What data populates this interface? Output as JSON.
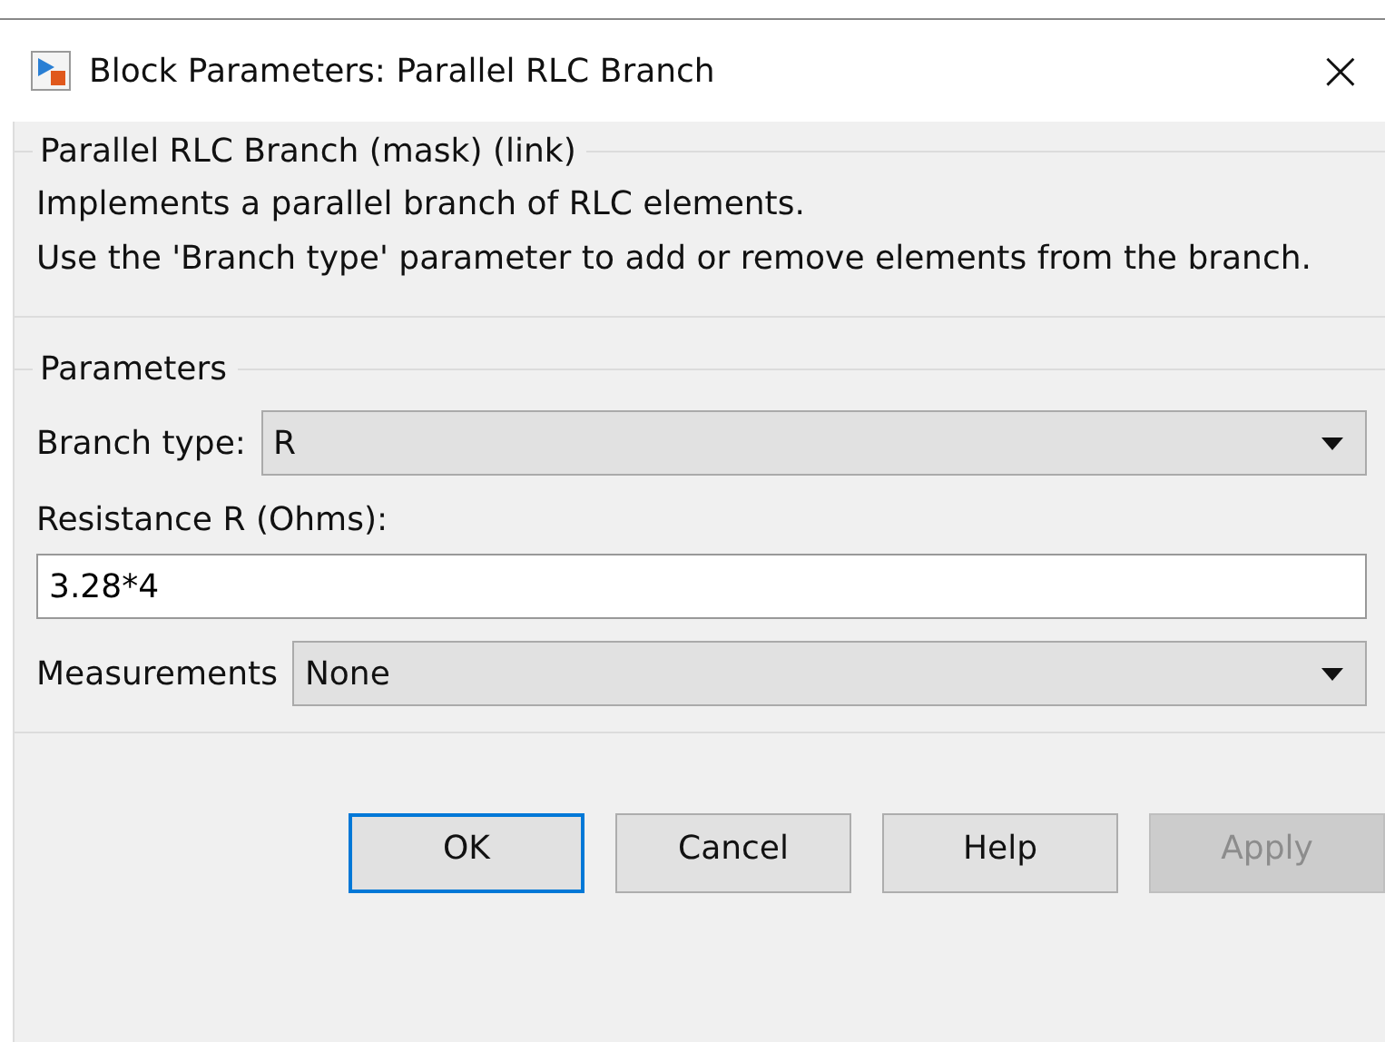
{
  "window": {
    "title": "Block Parameters: Parallel RLC Branch",
    "close": "×"
  },
  "description": {
    "legend": "Parallel RLC Branch (mask) (link)",
    "lines": [
      "Implements a parallel branch of RLC elements.",
      "Use the 'Branch type' parameter to add or remove elements from the branch."
    ]
  },
  "parameters": {
    "legend": "Parameters",
    "fields": [
      {
        "kind": "dropdown",
        "label": "Branch type:",
        "value": "R"
      },
      {
        "kind": "text",
        "label": "Resistance R (Ohms):",
        "value": "3.28*4"
      },
      {
        "kind": "dropdown",
        "label": "Measurements",
        "value": "None"
      }
    ]
  },
  "buttons": [
    {
      "label": "OK",
      "default": true,
      "disabled": false
    },
    {
      "label": "Cancel",
      "default": false,
      "disabled": false
    },
    {
      "label": "Help",
      "default": false,
      "disabled": false
    },
    {
      "label": "Apply",
      "default": false,
      "disabled": true
    }
  ]
}
